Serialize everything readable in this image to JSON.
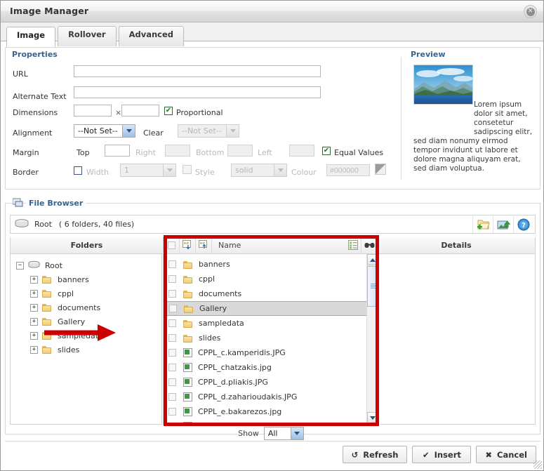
{
  "window": {
    "title": "Image Manager",
    "close_label": "✕"
  },
  "tabs": [
    {
      "label": "Image",
      "active": true
    },
    {
      "label": "Rollover",
      "active": false
    },
    {
      "label": "Advanced",
      "active": false
    }
  ],
  "properties": {
    "legend": "Properties",
    "url": {
      "label": "URL",
      "value": "",
      "placeholder": ""
    },
    "alt": {
      "label": "Alternate Text",
      "value": "",
      "placeholder": ""
    },
    "dimensions": {
      "label": "Dimensions",
      "width": "",
      "height": "",
      "separator": "×",
      "proportional_label": "Proportional",
      "proportional_checked": true
    },
    "alignment": {
      "label": "Alignment",
      "value": "--Not Set--",
      "clear_label": "Clear",
      "clear_value": "--Not Set--"
    },
    "margin": {
      "label": "Margin",
      "top_label": "Top",
      "top_value": "",
      "right_label": "Right",
      "right_value": "",
      "bottom_label": "Bottom",
      "bottom_value": "",
      "left_label": "Left",
      "left_value": "",
      "equal_label": "Equal Values",
      "equal_checked": true
    },
    "border": {
      "label": "Border",
      "enabled": false,
      "width_label": "Width",
      "width_value": "1",
      "style_label": "Style",
      "style_value": "solid",
      "colour_label": "Colour",
      "colour_value": "#000000"
    }
  },
  "preview": {
    "legend": "Preview",
    "text": "Lorem ipsum dolor sit amet, consetetur sadipscing elitr, sed diam nonumy eirmod tempor invidunt ut labore et dolore magna aliquyam erat, sed diam voluptua."
  },
  "file_browser": {
    "legend": "File Browser",
    "root_label": "Root",
    "root_count": "( 6 folders, 40 files)",
    "toolbar_icons": [
      "new-folder-icon",
      "upload-image-icon",
      "help-icon"
    ],
    "columns": {
      "folders": "Folders",
      "name": "Name",
      "details": "Details"
    },
    "tree": [
      {
        "label": "Root",
        "expander": "−",
        "icon": "disk-icon",
        "depth": 0
      },
      {
        "label": "banners",
        "expander": "+",
        "icon": "folder-icon",
        "depth": 1
      },
      {
        "label": "cppl",
        "expander": "+",
        "icon": "folder-icon",
        "depth": 1
      },
      {
        "label": "documents",
        "expander": "+",
        "icon": "folder-icon",
        "depth": 1
      },
      {
        "label": "Gallery",
        "expander": "+",
        "icon": "folder-icon",
        "depth": 1
      },
      {
        "label": "sampledata",
        "expander": "+",
        "icon": "folder-icon",
        "depth": 1
      },
      {
        "label": "slides",
        "expander": "+",
        "icon": "folder-icon",
        "depth": 1
      }
    ],
    "files": [
      {
        "name": "banners",
        "type": "folder",
        "selected": false
      },
      {
        "name": "cppl",
        "type": "folder",
        "selected": false
      },
      {
        "name": "documents",
        "type": "folder",
        "selected": false
      },
      {
        "name": "Gallery",
        "type": "folder",
        "selected": true
      },
      {
        "name": "sampledata",
        "type": "folder",
        "selected": false
      },
      {
        "name": "slides",
        "type": "folder",
        "selected": false
      },
      {
        "name": "CPPL_c.kamperidis.JPG",
        "type": "image",
        "selected": false
      },
      {
        "name": "CPPL_chatzakis.jpg",
        "type": "image",
        "selected": false
      },
      {
        "name": "CPPL_d.pliakis.JPG",
        "type": "image",
        "selected": false
      },
      {
        "name": "CPPL_d.zaharioudakis.JPG",
        "type": "image",
        "selected": false
      },
      {
        "name": "CPPL_e.bakarezos.jpg",
        "type": "image",
        "selected": false
      }
    ],
    "show": {
      "label": "Show",
      "value": "All"
    }
  },
  "footer": {
    "refresh": "Refresh",
    "insert": "Insert",
    "cancel": "Cancel",
    "refresh_glyph": "↺",
    "insert_glyph": "✔",
    "cancel_glyph": "✖"
  },
  "annotations": {
    "highlight_color": "#cc0000",
    "arrow_target": "sampledata"
  }
}
